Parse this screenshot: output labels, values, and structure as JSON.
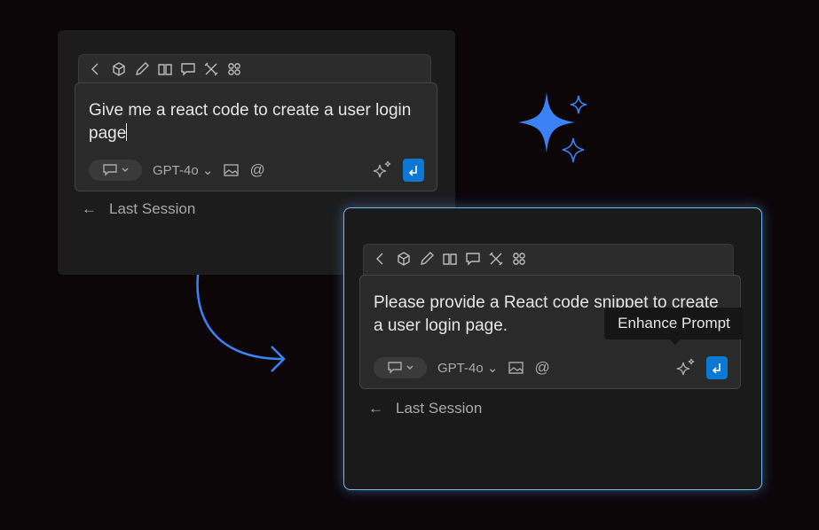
{
  "before": {
    "prompt": "Give me a react code to create a  user login page",
    "model": "GPT-4o",
    "last_session": "Last Session"
  },
  "after": {
    "prompt": "Please provide a React code snippet to create a user login page.",
    "model": "GPT-4o",
    "last_session": "Last Session",
    "tooltip": "Enhance Prompt"
  },
  "toolbar_icons": [
    "back-icon",
    "cube-icon",
    "pencil-icon",
    "book-icon",
    "chat-icon",
    "tools-icon",
    "grid-icon"
  ],
  "colors": {
    "accent": "#0a78d4",
    "highlight_border": "#6cbcf0",
    "sparkle": "#3b82f6"
  }
}
